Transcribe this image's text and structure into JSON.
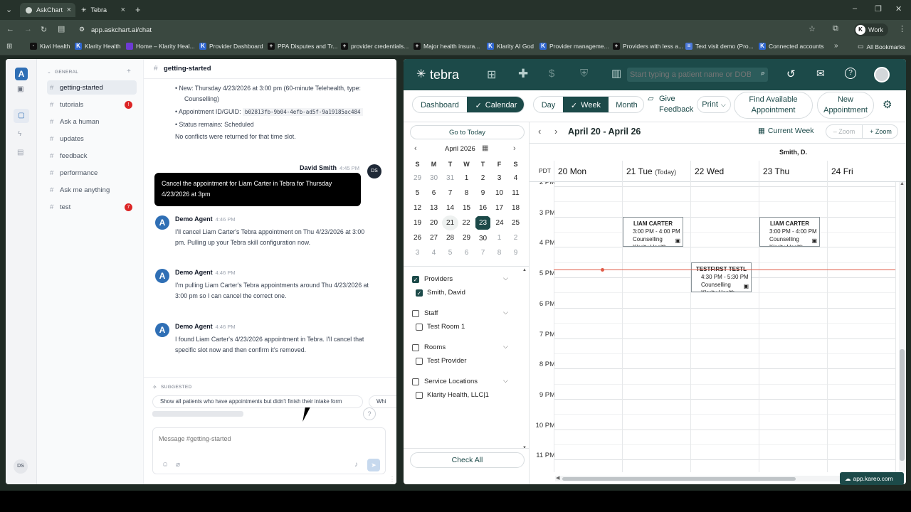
{
  "browser": {
    "tabs": [
      {
        "label": "AskChart"
      },
      {
        "label": "Tebra"
      }
    ],
    "url": "app.askchart.ai/chat",
    "profile": "Work",
    "bookmarks": [
      {
        "label": "Kiwi Health",
        "icon": "K"
      },
      {
        "label": "Klarity Health",
        "icon": "K"
      },
      {
        "label": "Home – Klarity Heal...",
        "icon": "■"
      },
      {
        "label": "Provider Dashboard",
        "icon": "K"
      },
      {
        "label": "PPA Disputes and Tr...",
        "icon": "+"
      },
      {
        "label": "provider credentials...",
        "icon": "+"
      },
      {
        "label": "Major health insura...",
        "icon": "+"
      },
      {
        "label": "Klarity AI God",
        "icon": "K"
      },
      {
        "label": "Provider manageme...",
        "icon": "K"
      },
      {
        "label": "Providers with less a...",
        "icon": "+"
      },
      {
        "label": "Text visit demo (Pro...",
        "icon": "≡"
      },
      {
        "label": "Connected accounts",
        "icon": "K"
      }
    ],
    "all_bookmarks": "All Bookmarks"
  },
  "askchart": {
    "logo": "A",
    "section_label": "GENERAL",
    "channels": [
      {
        "name": "getting-started",
        "badge": ""
      },
      {
        "name": "tutorials",
        "badge": "!"
      },
      {
        "name": "Ask a human",
        "badge": ""
      },
      {
        "name": "updates",
        "badge": ""
      },
      {
        "name": "feedback",
        "badge": ""
      },
      {
        "name": "performance",
        "badge": ""
      },
      {
        "name": "Ask me anything",
        "badge": ""
      },
      {
        "name": "test",
        "badge": "7"
      }
    ],
    "user_initials": "DS",
    "channel_title": "getting-started",
    "prev_bullets": [
      "New: Thursday 4/23/2026 at 3:00 pm (60-minute Telehealth, type:",
      "Counselling)",
      "Appointment ID/GUID:",
      "b02813fb-9b04-4efb-ad5f-9a19185ac484",
      "Status remains: Scheduled",
      "No conflicts were returned for that time slot."
    ],
    "user_msg": {
      "author": "David Smith",
      "time": "4:45 PM",
      "initials": "DS",
      "text1": "Cancel the appointment for Liam Carter in Tebra for Thursday",
      "text2": "4/23/2026 at 3pm"
    },
    "agent_msgs": [
      {
        "author": "Demo Agent",
        "time": "4:46 PM",
        "line1": "I'll cancel Liam Carter's Tebra appointment on Thu 4/23/2026 at 3:00",
        "line2": "pm. Pulling up your Tebra skill configuration now."
      },
      {
        "author": "Demo Agent",
        "time": "4:46 PM",
        "line1": "I'm pulling Liam Carter's Tebra appointments around Thu 4/23/2026 at",
        "line2": "3:00 pm so I can cancel the correct one."
      },
      {
        "author": "Demo Agent",
        "time": "4:46 PM",
        "line1": "I found Liam Carter's 4/23/2026 appointment in Tebra. I'll cancel that",
        "line2": "specific slot now and then confirm it's removed."
      }
    ],
    "suggested_label": "SUGGESTED",
    "suggestions": [
      "Show all patients who have appointments but didn't finish their intake form",
      "Whi"
    ],
    "input_placeholder": "Message #getting-started"
  },
  "tebra": {
    "logo": "tebra",
    "search_placeholder": "Start typing a patient name or DOB",
    "tabs": [
      "Dashboard",
      "Calendar"
    ],
    "views": [
      "Day",
      "Week",
      "Month"
    ],
    "give_feedback": "Give Feedback",
    "print": "Print",
    "find_appt": "Find Available Appointment",
    "new_appt": "New Appointment",
    "go_today": "Go to Today",
    "month_label": "April 2026",
    "weekday_heads": [
      "S",
      "M",
      "T",
      "W",
      "T",
      "F",
      "S"
    ],
    "weeks": [
      [
        "29",
        "30",
        "31",
        "1",
        "2",
        "3",
        "4"
      ],
      [
        "5",
        "6",
        "7",
        "8",
        "9",
        "10",
        "11"
      ],
      [
        "12",
        "13",
        "14",
        "15",
        "16",
        "17",
        "18"
      ],
      [
        "19",
        "20",
        "21",
        "22",
        "23",
        "24",
        "25"
      ],
      [
        "26",
        "27",
        "28",
        "29",
        "30",
        "1",
        "2"
      ],
      [
        "3",
        "4",
        "5",
        "6",
        "7",
        "8",
        "9"
      ]
    ],
    "filters": [
      {
        "group": "Providers",
        "checked": true,
        "item": "Smith, David",
        "item_checked": true
      },
      {
        "group": "Staff",
        "checked": false,
        "item": "Test Room 1",
        "item_checked": false
      },
      {
        "group": "Rooms",
        "checked": false,
        "item": "Test Provider",
        "item_checked": false
      },
      {
        "group": "Service Locations",
        "checked": false,
        "item": "Klarity Health, LLC|1",
        "item_checked": false
      }
    ],
    "check_all": "Check All",
    "range_label": "April 20 - April 26",
    "current_week": "Current Week",
    "zoom_out": "Zoom",
    "zoom_in": "Zoom",
    "provider": "Smith, D.",
    "tz": "PDT",
    "days": [
      {
        "num": "20",
        "name": "Mon",
        "extra": ""
      },
      {
        "num": "21",
        "name": "Tue",
        "extra": "(Today)"
      },
      {
        "num": "22",
        "name": "Wed",
        "extra": ""
      },
      {
        "num": "23",
        "name": "Thu",
        "extra": ""
      },
      {
        "num": "24",
        "name": "Fri",
        "extra": ""
      }
    ],
    "hours": [
      "2 PM",
      "3 PM",
      "4 PM",
      "5 PM",
      "6 PM",
      "7 PM",
      "8 PM",
      "9 PM",
      "10 PM",
      "11 PM"
    ],
    "appointments": [
      {
        "name": "LIAM CARTER",
        "time": "3:00 PM - 4:00 PM",
        "type": "Counselling",
        "loc": "Klarity Health"
      },
      {
        "name": "TESTFIRST TESTL",
        "time": "4:30 PM - 5:30 PM",
        "type": "Counselling",
        "loc": "Klarity Health"
      },
      {
        "name": "LIAM CARTER",
        "time": "3:00 PM - 4:00 PM",
        "type": "Counselling",
        "loc": "Klarity Health"
      }
    ],
    "footer_domain": "app.kareo.com"
  }
}
